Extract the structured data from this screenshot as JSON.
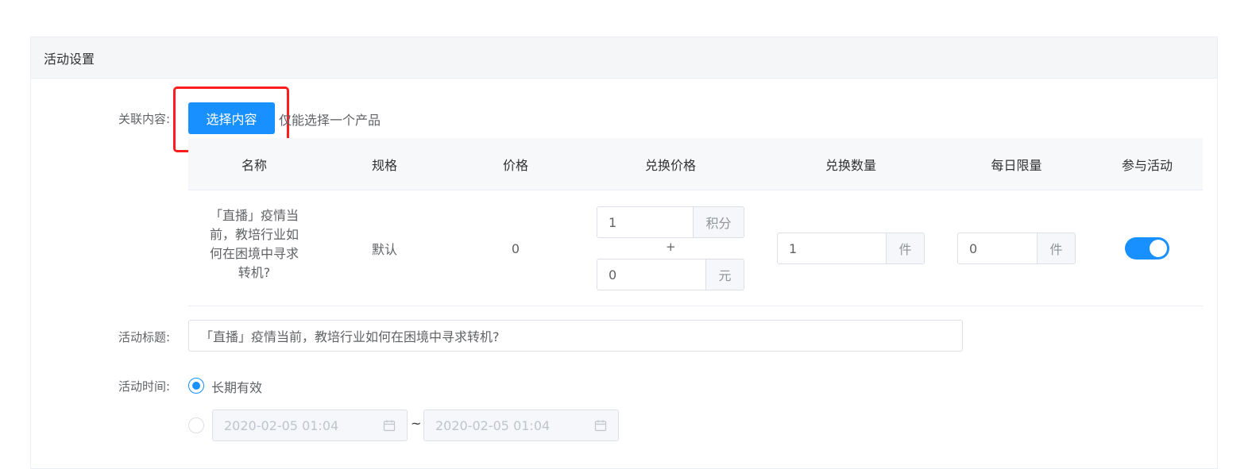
{
  "card": {
    "title": "活动设置"
  },
  "related": {
    "label": "关联内容:",
    "select_button": "选择内容",
    "hint": "仅能选择一个产品"
  },
  "table": {
    "headers": [
      "名称",
      "规格",
      "价格",
      "兑换价格",
      "兑换数量",
      "每日限量",
      "参与活动"
    ],
    "row": {
      "name_lines": [
        "「直播」疫情当",
        "前，教培行业如",
        "何在困境中寻求",
        "转机?"
      ],
      "spec": "默认",
      "price": "0",
      "exchange_points": "1",
      "points_unit": "积分",
      "plus": "+",
      "exchange_cash": "0",
      "cash_unit": "元",
      "exchange_qty": "1",
      "qty_unit": "件",
      "daily_limit": "0",
      "limit_unit": "件",
      "participate": true
    }
  },
  "activity_title": {
    "label": "活动标题:",
    "value": "「直播」疫情当前，教培行业如何在困境中寻求转机?"
  },
  "activity_time": {
    "label": "活动时间:",
    "option_long_term": "长期有效",
    "long_term_selected": true,
    "start": "2020-02-05 01:04",
    "separator": "~",
    "end": "2020-02-05 01:04"
  },
  "colors": {
    "primary": "#1890ff",
    "highlight": "#ff1d1d"
  },
  "icons": {
    "calendar": "calendar-icon"
  }
}
